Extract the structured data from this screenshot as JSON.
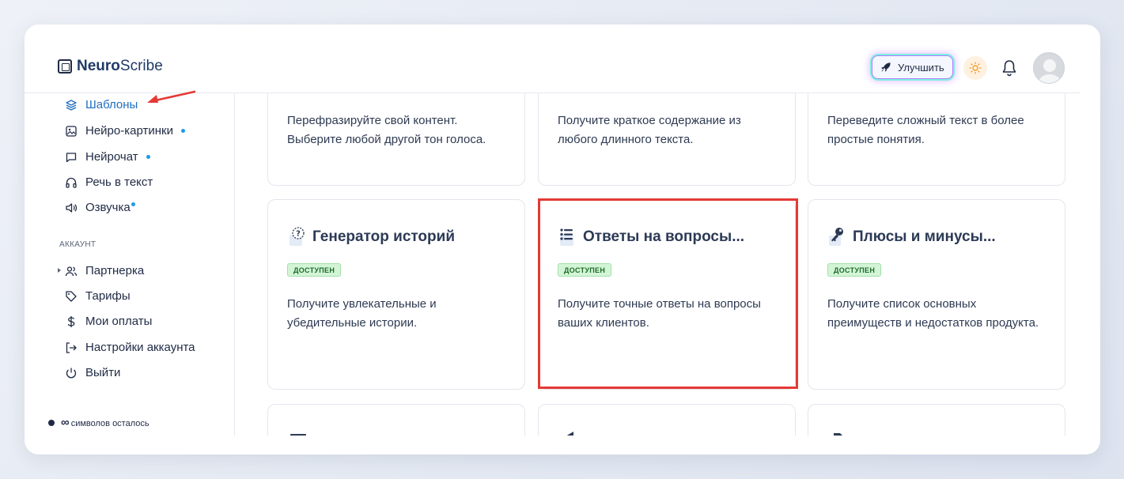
{
  "app": {
    "logo_bold": "Neuro",
    "logo_light": "Scribe"
  },
  "header": {
    "upgrade_label": "Улучшить"
  },
  "sidebar": {
    "items": [
      {
        "label": "Шаблоны",
        "icon": "layers-icon",
        "active": true
      },
      {
        "label": "Нейро-картинки",
        "icon": "image-icon",
        "dot": true
      },
      {
        "label": "Нейрочат",
        "icon": "chat-icon",
        "dot": true
      },
      {
        "label": "Речь в текст",
        "icon": "headphones-icon"
      },
      {
        "label": "Озвучка",
        "icon": "speaker-icon",
        "dot": true
      }
    ],
    "section_label": "АККАУНТ",
    "account_items": [
      {
        "label": "Партнерка",
        "icon": "users-icon"
      },
      {
        "label": "Тарифы",
        "icon": "tag-icon"
      },
      {
        "label": "Мои оплаты",
        "icon": "dollar-icon"
      },
      {
        "label": "Настройки аккаунта",
        "icon": "login-icon"
      },
      {
        "label": "Выйти",
        "icon": "power-icon"
      }
    ],
    "credits_symbol": "∞",
    "credits_text": "символов осталось"
  },
  "cards": {
    "row1": [
      {
        "desc": "Перефразируйте свой контент. Выберите любой другой тон голоса."
      },
      {
        "desc": "Получите краткое содержание из любого длинного текста."
      },
      {
        "desc": "Переведите сложный текст в более простые понятия."
      }
    ],
    "row2": [
      {
        "title": "Генератор историй",
        "badge": "ДОСТУПЕН",
        "desc": "Получите увлекательные и убедительные истории.",
        "icon": "question-icon"
      },
      {
        "title": "Ответы на вопросы...",
        "badge": "ДОСТУПЕН",
        "desc": "Получите точные ответы на вопросы ваших клиентов.",
        "icon": "list-icon"
      },
      {
        "title": "Плюсы и минусы...",
        "badge": "ДОСТУПЕН",
        "desc": "Получите список основных преимуществ и недостатков продукта.",
        "icon": "key-icon"
      }
    ]
  },
  "colors": {
    "accent": "#1f6fbf",
    "badge_bg": "#d3f5d6",
    "highlight": "#e53935",
    "dot": "#1a9be8"
  }
}
